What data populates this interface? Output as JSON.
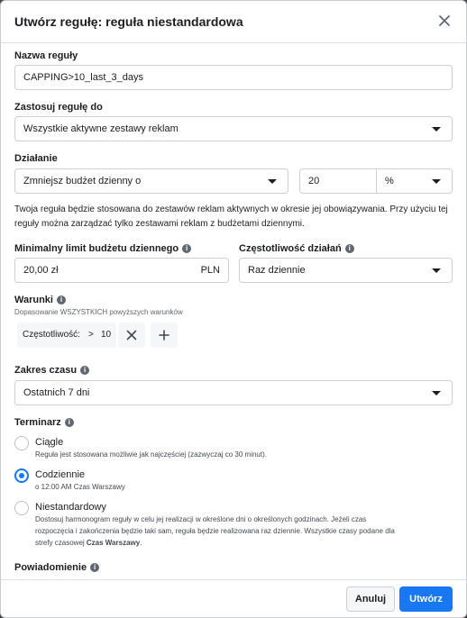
{
  "dialog": {
    "title": "Utwórz regułę: reguła niestandardowa",
    "close_icon": "close-icon"
  },
  "rule_name": {
    "label": "Nazwa reguły",
    "value": "CAPPING>10_last_3_days"
  },
  "apply_to": {
    "label": "Zastosuj regułę do",
    "value": "Wszystkie aktywne zestawy reklam"
  },
  "action": {
    "label": "Działanie",
    "value": "Zmniejsz budżet dzienny o",
    "amount": "20",
    "unit": "%",
    "help": "Twoja reguła będzie stosowana do zestawów reklam aktywnych w okresie jej obowiązywania. Przy użyciu tej reguły można zarządzać tylko zestawami reklam z budżetami dziennymi."
  },
  "min_budget": {
    "label": "Minimalny limit budżetu dziennego",
    "value": "20,00 zł",
    "currency": "PLN"
  },
  "frequency": {
    "label": "Częstotliwość działań",
    "value": "Raz dziennie"
  },
  "conditions": {
    "label": "Warunki",
    "subtitle": "Dopasowanie WSZYSTKICH powyższych warunków",
    "chip": {
      "metric": "Częstotliwość:",
      "operator": ">",
      "value": "10"
    }
  },
  "time_range": {
    "label": "Zakres czasu",
    "value": "Ostatnich 7 dni"
  },
  "schedule": {
    "label": "Terminarz",
    "options": [
      {
        "title": "Ciągle",
        "desc": "Reguła jest stosowana możliwie jak najczęściej (zazwyczaj co 30 minut).",
        "selected": false
      },
      {
        "title": "Codziennie",
        "desc": "o 12:00 AM Czas Warszawy",
        "selected": true
      },
      {
        "title": "Niestandardowy",
        "desc_1": "Dostosuj harmonogram reguły w celu jej realizacji w określone dni o określonych godzinach. Jeżeli czas",
        "desc_2": "rozpoczęcia i zakończenia będzie taki sam, reguła będzie realizowana raz dziennie. Wszystkie czasy podane dla",
        "desc_3_a": "strefy czasowej ",
        "desc_3_b": "Czas Warszawy",
        "desc_3_c": ".",
        "selected": false
      }
    ]
  },
  "notification": {
    "label": "Powiadomienie"
  },
  "footer": {
    "cancel": "Anuluj",
    "create": "Utwórz"
  },
  "colors": {
    "primary": "#1877f2",
    "border": "#ccd0d5"
  }
}
